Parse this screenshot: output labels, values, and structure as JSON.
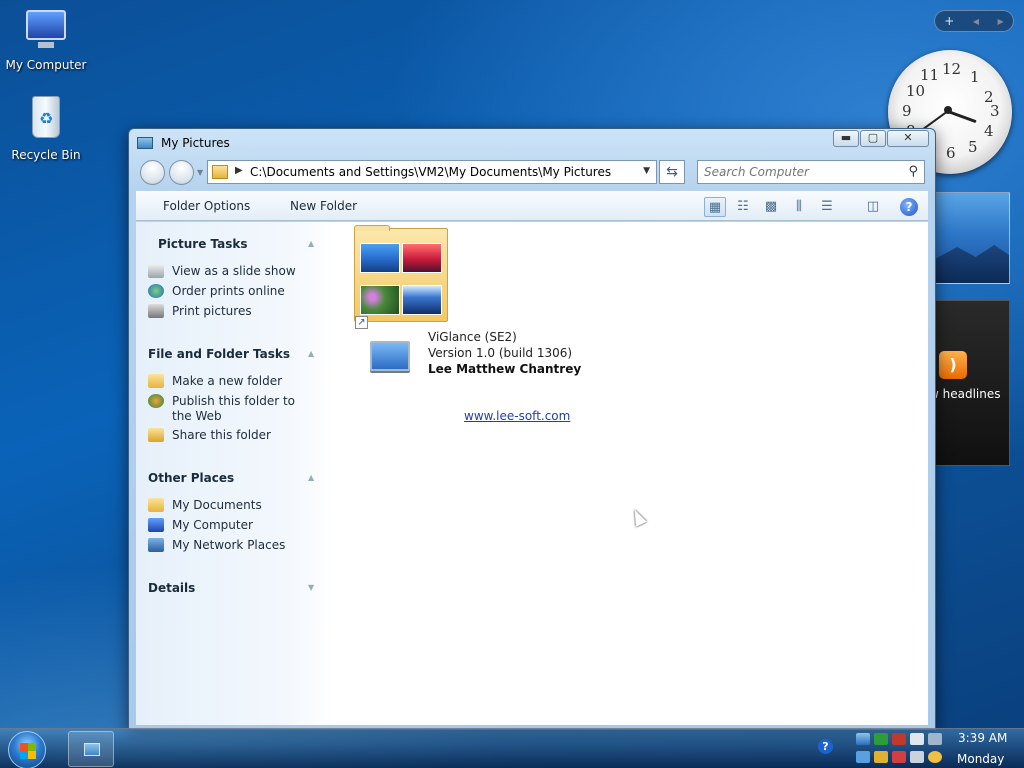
{
  "desktop": {
    "icons": [
      {
        "label": "My Computer"
      },
      {
        "label": "Recycle Bin"
      }
    ]
  },
  "gadgets": {
    "controls": [
      "+",
      "◀",
      "▶"
    ],
    "clock": {
      "numbers": [
        "12",
        "1",
        "2",
        "3",
        "4",
        "5",
        "6",
        "7",
        "8",
        "9",
        "10",
        "11"
      ],
      "time": "3:39"
    },
    "feed_label": "w headlines"
  },
  "window": {
    "title": "My Pictures",
    "caption_buttons": {
      "minimize": "▬",
      "maximize": "▢",
      "close": "✕"
    },
    "address": "C:\\Documents and Settings\\VM2\\My Documents\\My Pictures",
    "search_placeholder": "Search Computer",
    "toolbar": {
      "folder_options": "Folder Options",
      "new_folder": "New Folder",
      "help": "?"
    },
    "task_pane": {
      "sections": [
        {
          "title": "Picture Tasks",
          "items": [
            "View as a slide show",
            "Order prints online",
            "Print pictures"
          ]
        },
        {
          "title": "File and Folder Tasks",
          "items": [
            "Make a new folder",
            "Publish this folder to the Web",
            "Share this folder"
          ]
        },
        {
          "title": "Other Places",
          "items": [
            "My Documents",
            "My Computer",
            "My Network Places"
          ]
        },
        {
          "title": "Details",
          "items": []
        }
      ]
    },
    "content": {
      "app_name": "ViGlance (SE2)",
      "app_version": "Version 1.0 (build 1306)",
      "app_author": "Lee Matthew Chantrey",
      "app_link": "www.lee-soft.com"
    }
  },
  "taskbar": {
    "time": "3:39 AM",
    "day": "Monday",
    "tray_help": "?"
  },
  "colors": {
    "link": "#1e3fb0",
    "desktop_blue": "#0a63b8"
  }
}
